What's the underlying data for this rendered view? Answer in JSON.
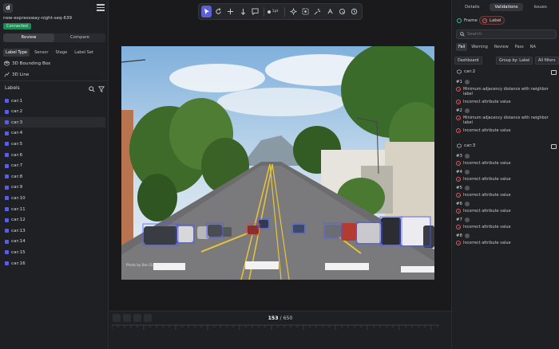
{
  "app": {
    "logo": "d",
    "sequence_name": "new-expressway-night-seq-639",
    "status_badge": "Connected"
  },
  "left": {
    "mode_tabs": [
      "Review",
      "Compare"
    ],
    "filter_tabs": [
      "Label Type",
      "Sensor",
      "Stage",
      "Label Set"
    ],
    "label_types": [
      "3D Bounding Box",
      "3D Line"
    ],
    "labels_title": "Labels",
    "labels": [
      "car:1",
      "car:2",
      "car:3",
      "car:4",
      "car:5",
      "car:6",
      "car:7",
      "car:8",
      "car:9",
      "car:10",
      "car:11",
      "car:12",
      "car:13",
      "car:14",
      "car:15",
      "car:16"
    ],
    "selected_label": "car:3"
  },
  "toolbar": {
    "brush_size": "1pt"
  },
  "viewer": {
    "frame_current": "153",
    "frame_separator": "/",
    "frame_total": "650",
    "watermark": "Photo by Ben Dumond"
  },
  "right": {
    "tabs": [
      "Details",
      "Validations",
      "Issues"
    ],
    "active_tab": "Validations",
    "chips": [
      "Frame",
      "Label"
    ],
    "search_placeholder": "Search",
    "filter_tabs": [
      "Fail",
      "Warning",
      "Review",
      "Pass",
      "NA"
    ],
    "buttons": [
      "Dashboard",
      "Group by: Label",
      "All filters"
    ],
    "groups": [
      {
        "title": "car:2",
        "issues": [
          {
            "num": "#1",
            "items": [
              "Minimum adjacency distance with neighbor label",
              "Incorrect attribute value"
            ]
          },
          {
            "num": "#2",
            "items": [
              "Minimum adjacency distance with neighbor label",
              "Incorrect attribute value"
            ]
          }
        ]
      },
      {
        "title": "car:3",
        "issues": [
          {
            "num": "#3",
            "items": [
              "Incorrect attribute value"
            ]
          },
          {
            "num": "#4",
            "items": [
              "Incorrect attribute value"
            ]
          },
          {
            "num": "#5",
            "items": [
              "Incorrect attribute value"
            ]
          },
          {
            "num": "#6",
            "items": [
              "Incorrect attribute value"
            ]
          },
          {
            "num": "#7",
            "items": [
              "Incorrect attribute value"
            ]
          },
          {
            "num": "#8",
            "items": [
              "Incorrect attribute value"
            ]
          }
        ]
      }
    ]
  },
  "colors": {
    "accent": "#5b5fd8",
    "badge": "#1e8a55",
    "error": "#e05a58",
    "box": "#4a5bff"
  }
}
